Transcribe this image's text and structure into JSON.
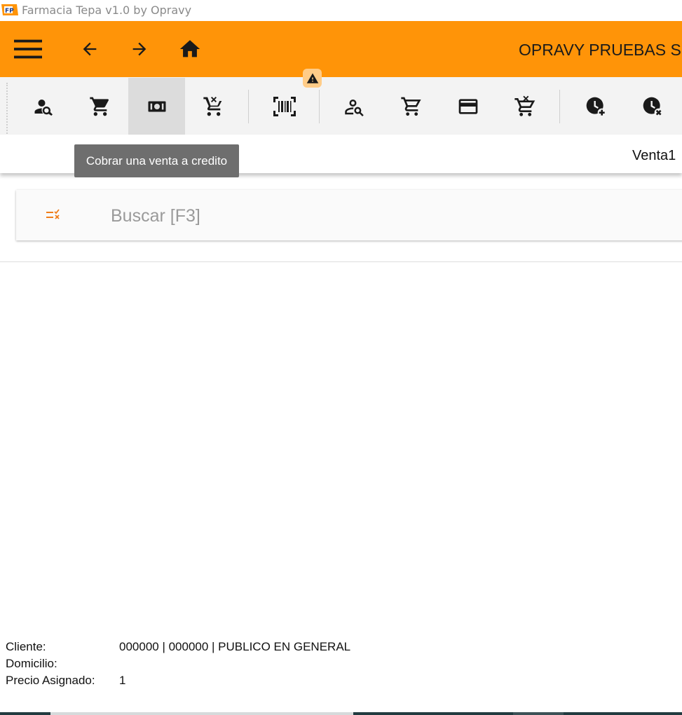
{
  "window": {
    "title": "Farmacia Tepa v1.0 by Opravy"
  },
  "header": {
    "company": "OPRAVY PRUEBAS S",
    "accent": "#ff9408"
  },
  "toolbar": {
    "tooltip": "Cobrar una venta a credito",
    "warning_icon": "warning-icon",
    "buttons": [
      {
        "icon": "person-search-icon"
      },
      {
        "icon": "shopping-cart-icon"
      },
      {
        "icon": "money-icon"
      },
      {
        "icon": "cart-remove-icon"
      },
      {
        "icon": "barcode-scan-icon"
      },
      {
        "icon": "person-search-outline-icon"
      },
      {
        "icon": "shopping-cart-outline-icon"
      },
      {
        "icon": "credit-card-icon"
      },
      {
        "icon": "cart-remove-outline-icon"
      },
      {
        "icon": "clock-add-icon"
      },
      {
        "icon": "clock-remove-icon"
      }
    ]
  },
  "tabs": {
    "active": "Venta1"
  },
  "search": {
    "placeholder": "Buscar [F3]",
    "value": ""
  },
  "info": {
    "cliente_label": "Cliente:",
    "cliente_value": "000000 | 000000 | PUBLICO EN GENERAL",
    "domicilio_label": "Domicilio:",
    "domicilio_value": "",
    "precio_label": "Precio Asignado:",
    "precio_value": "1"
  }
}
